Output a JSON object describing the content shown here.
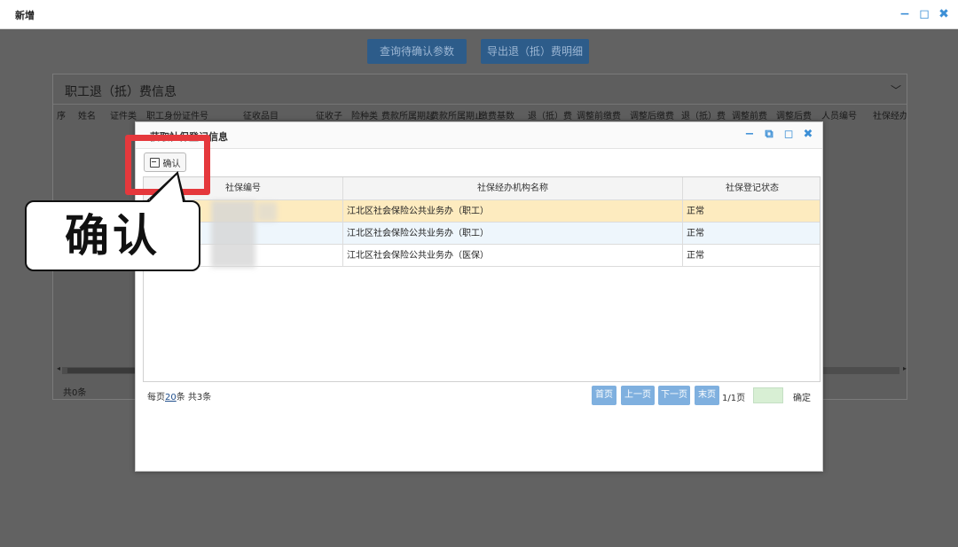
{
  "outer_window": {
    "title": "新增",
    "controls": {
      "minimize": "−",
      "maximize": "◻",
      "close": "✖"
    }
  },
  "toolbar": {
    "confirm_query_label": "查询待确认参数",
    "export_detail_label": "导出退（抵）费明细"
  },
  "panel": {
    "title": "职工退（抵）费信息",
    "collapse_icon": "chevron-down-icon",
    "collapse_glyph": "﹀",
    "columns": [
      "序",
      "姓名",
      "证件类",
      "职工身份证件号",
      "征收品目",
      "征收子",
      "险种类",
      "费款所属期起",
      "费款所属期止",
      "缴费基数",
      "退（抵）费",
      "调整前缴费",
      "调整后缴费",
      "退（抵）费",
      "调整前费",
      "调整后费",
      "人员编号",
      "社保经办"
    ],
    "record_count": "共0条",
    "scroll_left": "◂",
    "scroll_right": "▸"
  },
  "dialog": {
    "title": "获取社保登记信息",
    "controls": {
      "minimize": "−",
      "restore": "⧉",
      "maximize": "◻",
      "close": "✖"
    },
    "confirm_label": "确认",
    "confirm_icon": "save-icon",
    "grid": {
      "columns": [
        "社保编号",
        "社保经办机构名称",
        "社保登记状态"
      ],
      "rows": [
        {
          "number": "",
          "org": "江北区社会保险公共业务办（职工）",
          "status": "正常"
        },
        {
          "number": "",
          "org": "江北区社会保险公共业务办（职工）",
          "status": "正常"
        },
        {
          "number": "",
          "org": "江北区社会保险公共业务办（医保）",
          "status": "正常"
        }
      ]
    },
    "pager": {
      "per_page_prefix": "每页",
      "page_size": "20",
      "per_page_suffix": "条 共3条",
      "first": "首页",
      "prev": "上一页",
      "next": "下一页",
      "last": "末页",
      "page_of": "1/1页",
      "go": "确定"
    }
  },
  "annotation": {
    "callout_text": "确认",
    "highlight_color": "#e5383c"
  }
}
